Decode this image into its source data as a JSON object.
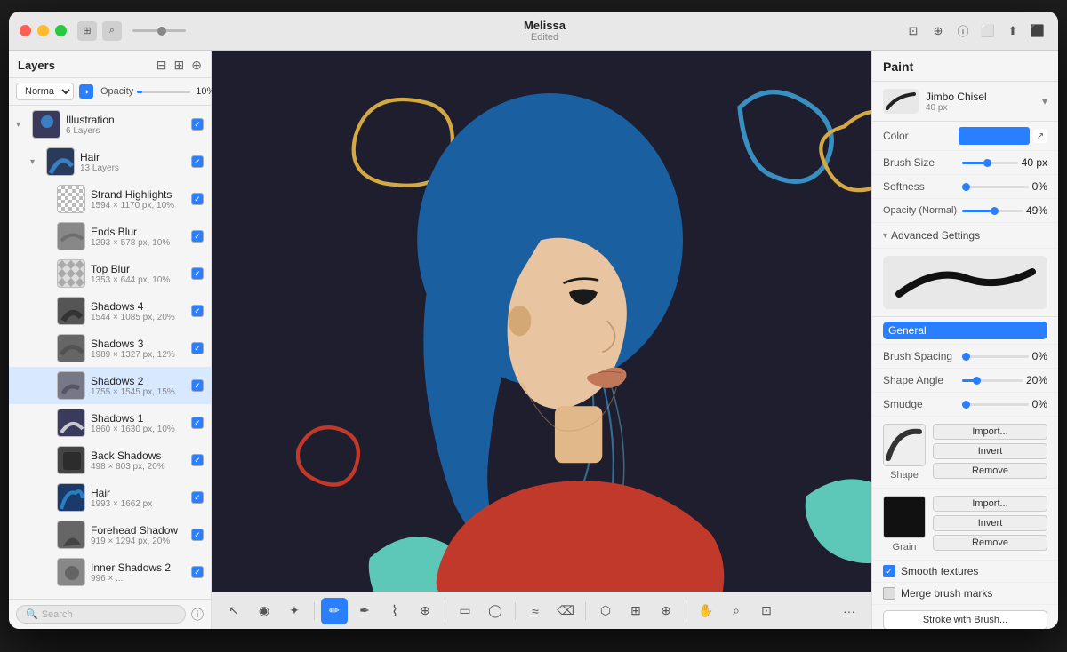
{
  "window": {
    "title": "Melissa",
    "subtitle": "Edited"
  },
  "toolbar": {
    "blend_mode": "Normal",
    "opacity_label": "Opacity",
    "opacity_value": "10%"
  },
  "layers": {
    "title": "Layers",
    "items": [
      {
        "id": "illustration",
        "name": "Illustration",
        "meta": "6 Layers",
        "level": 0,
        "expanded": true,
        "checked": true,
        "type": "folder"
      },
      {
        "id": "hair-group",
        "name": "Hair",
        "meta": "13 Layers",
        "level": 1,
        "expanded": true,
        "checked": true,
        "type": "folder"
      },
      {
        "id": "strand-highlights",
        "name": "Strand Highlights",
        "meta": "1594 × 1170 px, 10%",
        "level": 2,
        "checked": true,
        "type": "layer"
      },
      {
        "id": "ends-blur",
        "name": "Ends Blur",
        "meta": "1293 × 578 px, 10%",
        "level": 2,
        "checked": true,
        "type": "layer"
      },
      {
        "id": "top-blur",
        "name": "Top Blur",
        "meta": "1353 × 644 px, 10%",
        "level": 2,
        "checked": true,
        "type": "layer"
      },
      {
        "id": "shadows-4",
        "name": "Shadows 4",
        "meta": "1544 × 1085 px, 20%",
        "level": 2,
        "checked": true,
        "type": "layer"
      },
      {
        "id": "shadows-3",
        "name": "Shadows 3",
        "meta": "1989 × 1327 px, 12%",
        "level": 2,
        "checked": true,
        "type": "layer"
      },
      {
        "id": "shadows-2",
        "name": "Shadows 2",
        "meta": "1755 × 1545 px, 15%",
        "level": 2,
        "checked": true,
        "selected": true,
        "type": "layer"
      },
      {
        "id": "shadows-1",
        "name": "Shadows 1",
        "meta": "1860 × 1630 px, 10%",
        "level": 2,
        "checked": true,
        "type": "layer"
      },
      {
        "id": "back-shadows",
        "name": "Back Shadows",
        "meta": "498 × 803 px, 20%",
        "level": 2,
        "checked": true,
        "type": "layer"
      },
      {
        "id": "hair-layer",
        "name": "Hair",
        "meta": "1993 × 1662 px",
        "level": 2,
        "checked": true,
        "type": "layer"
      },
      {
        "id": "forehead-shadow",
        "name": "Forehead Shadow",
        "meta": "919 × 1294 px, 20%",
        "level": 2,
        "checked": true,
        "type": "layer"
      },
      {
        "id": "inner-shadows-2",
        "name": "Inner Shadows 2",
        "meta": "996 × ...",
        "level": 2,
        "checked": true,
        "type": "layer"
      }
    ]
  },
  "paint": {
    "title": "Paint",
    "brush": {
      "name": "Jimbo Chisel",
      "size": "40 px"
    },
    "color_label": "Color",
    "brush_size_label": "Brush Size",
    "brush_size_value": "40 px",
    "softness_label": "Softness",
    "softness_value": "0%",
    "opacity_label": "Opacity (Normal)",
    "opacity_value": "49%",
    "advanced_settings_label": "Advanced Settings",
    "general_label": "General",
    "brush_spacing_label": "Brush Spacing",
    "brush_spacing_value": "0%",
    "shape_angle_label": "Shape Angle",
    "shape_angle_value": "20%",
    "smudge_label": "Smudge",
    "smudge_value": "0%",
    "shape_label": "Shape",
    "grain_label": "Grain",
    "import_label": "Import...",
    "invert_label": "Invert",
    "remove_label": "Remove",
    "smooth_textures_label": "Smooth textures",
    "merge_brush_marks_label": "Merge brush marks",
    "stroke_with_brush_label": "Stroke with Brush..."
  },
  "tools": [
    {
      "id": "select",
      "symbol": "↖",
      "active": false
    },
    {
      "id": "fill",
      "symbol": "◉",
      "active": false
    },
    {
      "id": "star",
      "symbol": "✦",
      "active": false
    },
    {
      "id": "brush",
      "symbol": "✏",
      "active": true
    },
    {
      "id": "pencil",
      "symbol": "✒",
      "active": false
    },
    {
      "id": "pen",
      "symbol": "🖊",
      "active": false
    },
    {
      "id": "eyedropper",
      "symbol": "⊕",
      "active": false
    },
    {
      "id": "rect",
      "symbol": "▭",
      "active": false
    },
    {
      "id": "ellipse",
      "symbol": "◯",
      "active": false
    },
    {
      "id": "smudge",
      "symbol": "≈",
      "active": false
    },
    {
      "id": "eraser",
      "symbol": "⌫",
      "active": false
    },
    {
      "id": "lasso",
      "symbol": "⬡",
      "active": false
    },
    {
      "id": "transform",
      "symbol": "⊞",
      "active": false
    },
    {
      "id": "hand",
      "symbol": "✋",
      "active": false
    },
    {
      "id": "zoom",
      "symbol": "⌕",
      "active": false
    },
    {
      "id": "actions",
      "symbol": "⊡",
      "active": false
    }
  ],
  "search": {
    "placeholder": "Search"
  },
  "colors": {
    "accent": "#2a7fff",
    "bg_canvas": "#1a1a2e",
    "panel_bg": "#f5f5f5"
  }
}
